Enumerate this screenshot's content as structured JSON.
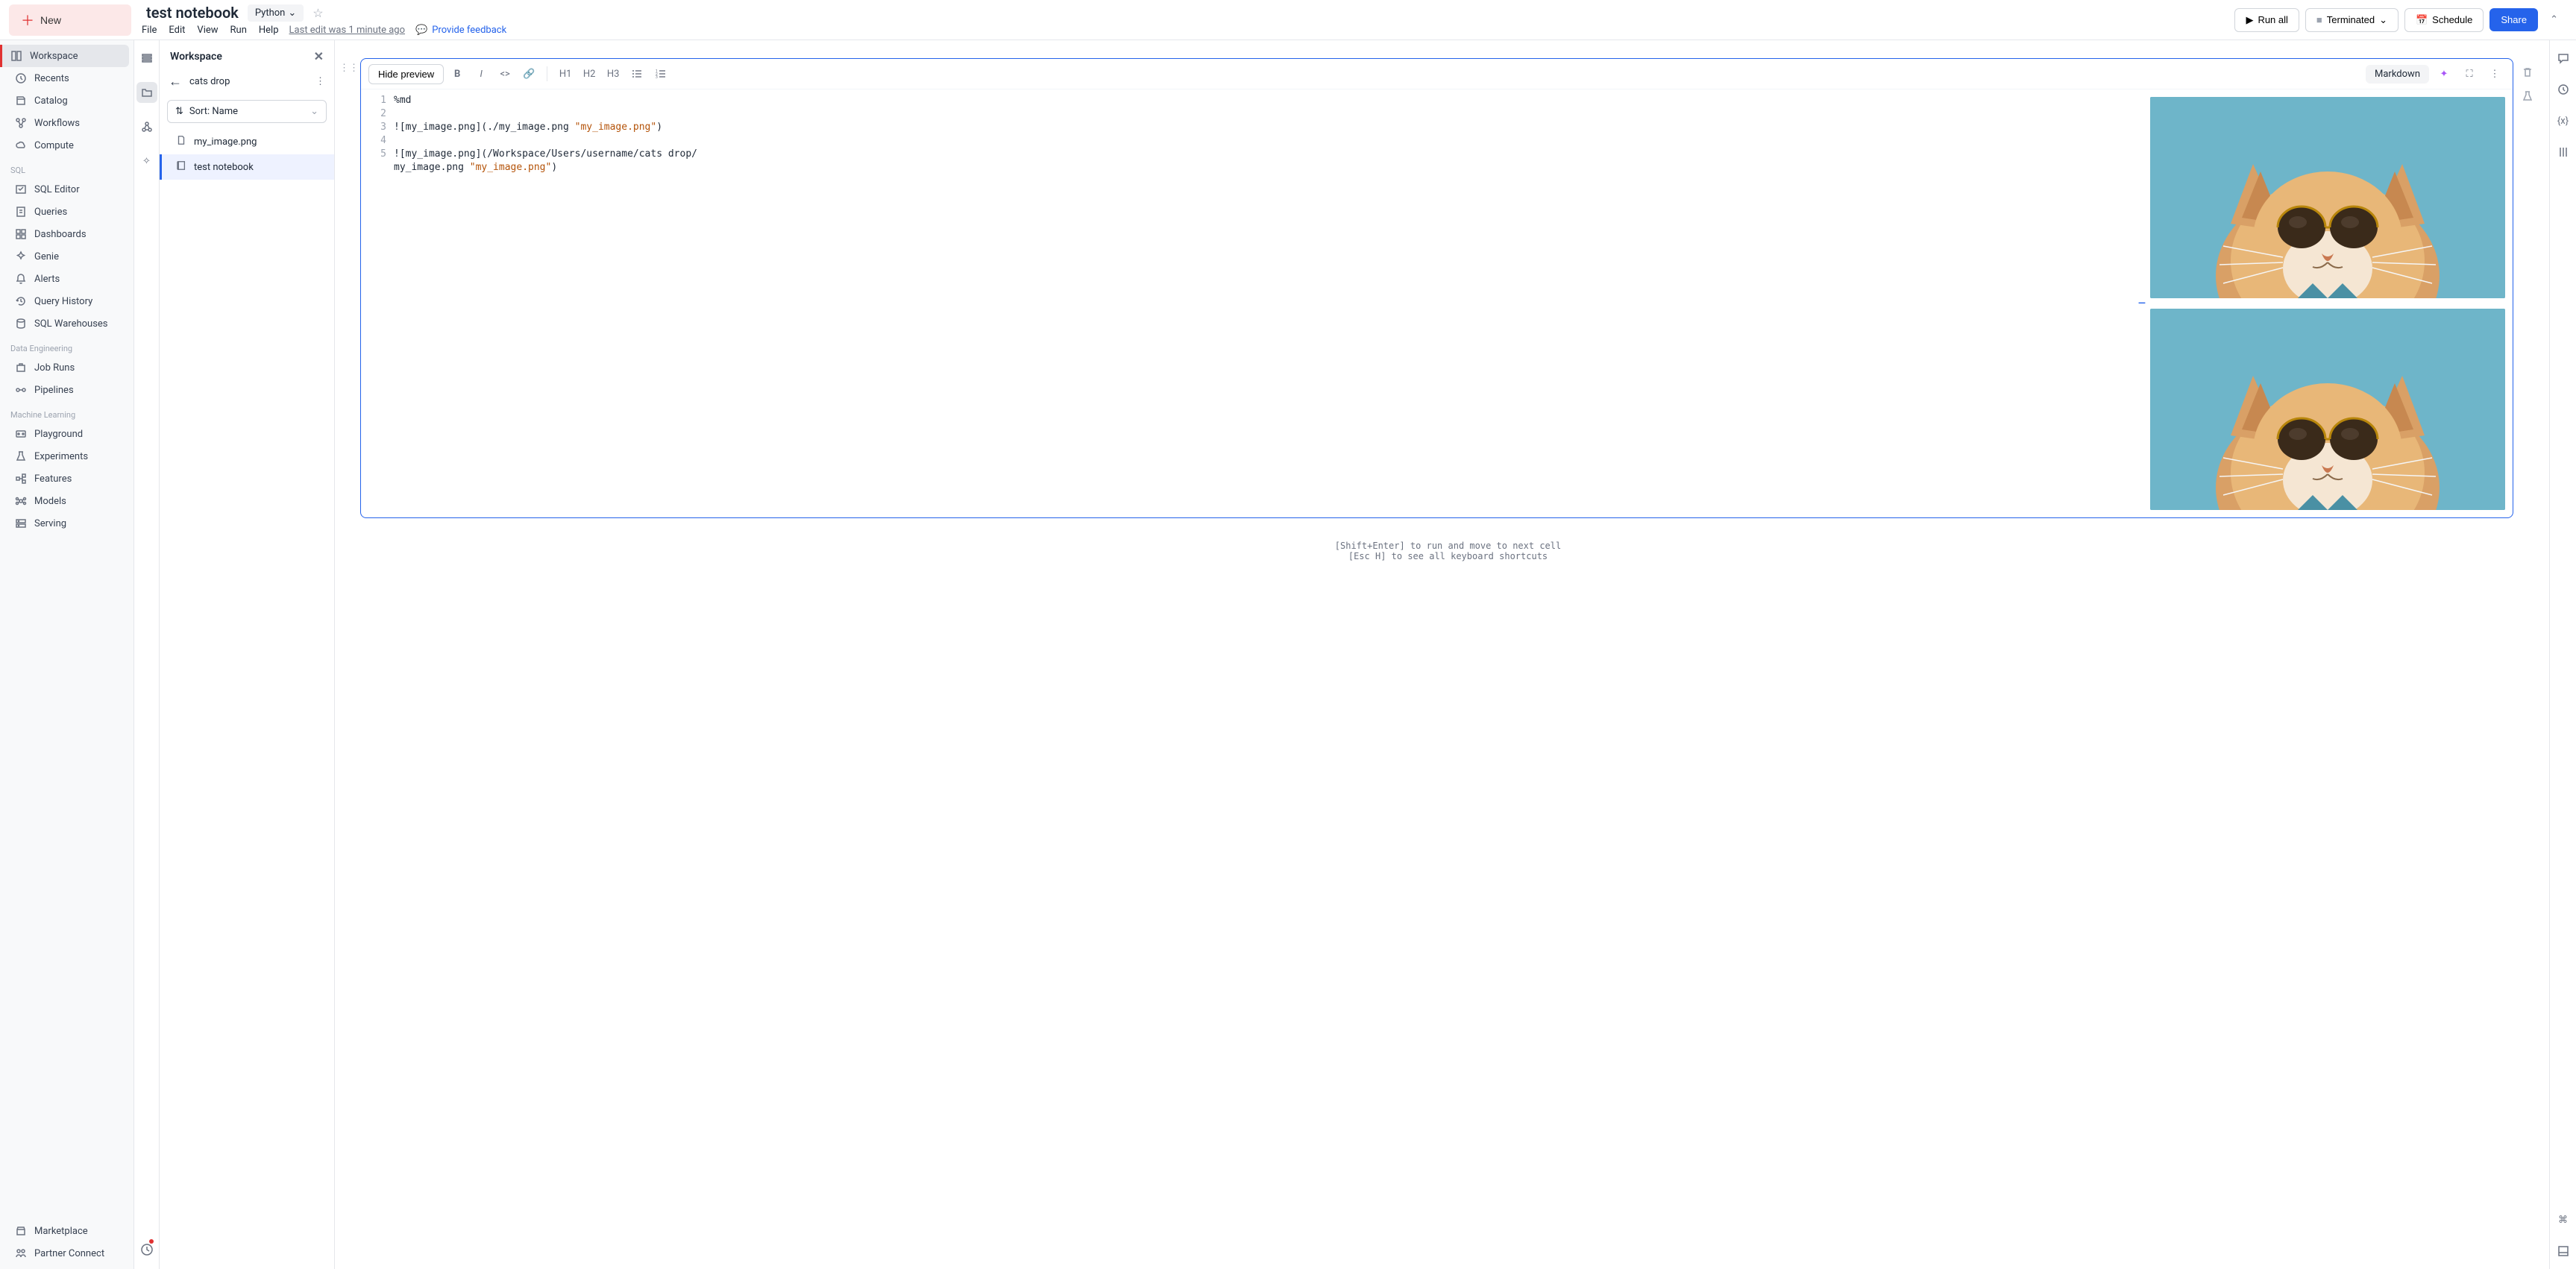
{
  "topbar": {
    "new_label": "New",
    "title": "test notebook",
    "language": "Python",
    "menus": [
      "File",
      "Edit",
      "View",
      "Run",
      "Help"
    ],
    "last_edit": "Last edit was 1 minute ago",
    "feedback": "Provide feedback",
    "run_all": "Run all",
    "status": "Terminated",
    "schedule": "Schedule",
    "share": "Share"
  },
  "sidebar": {
    "items_top": [
      {
        "icon": "workspace-icon",
        "label": "Workspace",
        "active": true
      },
      {
        "icon": "clock-icon",
        "label": "Recents"
      },
      {
        "icon": "catalog-icon",
        "label": "Catalog"
      },
      {
        "icon": "workflow-icon",
        "label": "Workflows"
      },
      {
        "icon": "cloud-icon",
        "label": "Compute"
      }
    ],
    "sql_label": "SQL",
    "items_sql": [
      {
        "icon": "sql-editor-icon",
        "label": "SQL Editor"
      },
      {
        "icon": "queries-icon",
        "label": "Queries"
      },
      {
        "icon": "dashboards-icon",
        "label": "Dashboards"
      },
      {
        "icon": "genie-icon",
        "label": "Genie"
      },
      {
        "icon": "alerts-icon",
        "label": "Alerts"
      },
      {
        "icon": "history-icon",
        "label": "Query History"
      },
      {
        "icon": "warehouse-icon",
        "label": "SQL Warehouses"
      }
    ],
    "de_label": "Data Engineering",
    "items_de": [
      {
        "icon": "job-icon",
        "label": "Job Runs"
      },
      {
        "icon": "pipeline-icon",
        "label": "Pipelines"
      }
    ],
    "ml_label": "Machine Learning",
    "items_ml": [
      {
        "icon": "playground-icon",
        "label": "Playground"
      },
      {
        "icon": "flask-icon",
        "label": "Experiments"
      },
      {
        "icon": "features-icon",
        "label": "Features"
      },
      {
        "icon": "models-icon",
        "label": "Models"
      },
      {
        "icon": "serving-icon",
        "label": "Serving"
      }
    ],
    "items_bottom": [
      {
        "icon": "marketplace-icon",
        "label": "Marketplace"
      },
      {
        "icon": "partner-icon",
        "label": "Partner Connect"
      }
    ]
  },
  "workspace_panel": {
    "title": "Workspace",
    "breadcrumb": "cats drop",
    "sort_label": "Sort: Name",
    "files": [
      {
        "icon": "file-icon",
        "name": "my_image.png",
        "selected": false
      },
      {
        "icon": "notebook-icon",
        "name": "test notebook",
        "selected": true
      }
    ]
  },
  "cell": {
    "hide_preview": "Hide preview",
    "headings": [
      "H1",
      "H2",
      "H3"
    ],
    "type_badge": "Markdown",
    "lines": [
      {
        "n": "1",
        "text": "%md"
      },
      {
        "n": "2",
        "text": ""
      },
      {
        "n": "3",
        "text": "![my_image.png](./my_image.png \"my_image.png\")"
      },
      {
        "n": "4",
        "text": ""
      },
      {
        "n": "5",
        "text": "![my_image.png](/Workspace/Users/username/cats drop/my_image.png \"my_image.png\")"
      }
    ]
  },
  "hints": {
    "line1": "[Shift+Enter] to run and move to next cell",
    "line2": "[Esc H] to see all keyboard shortcuts"
  }
}
